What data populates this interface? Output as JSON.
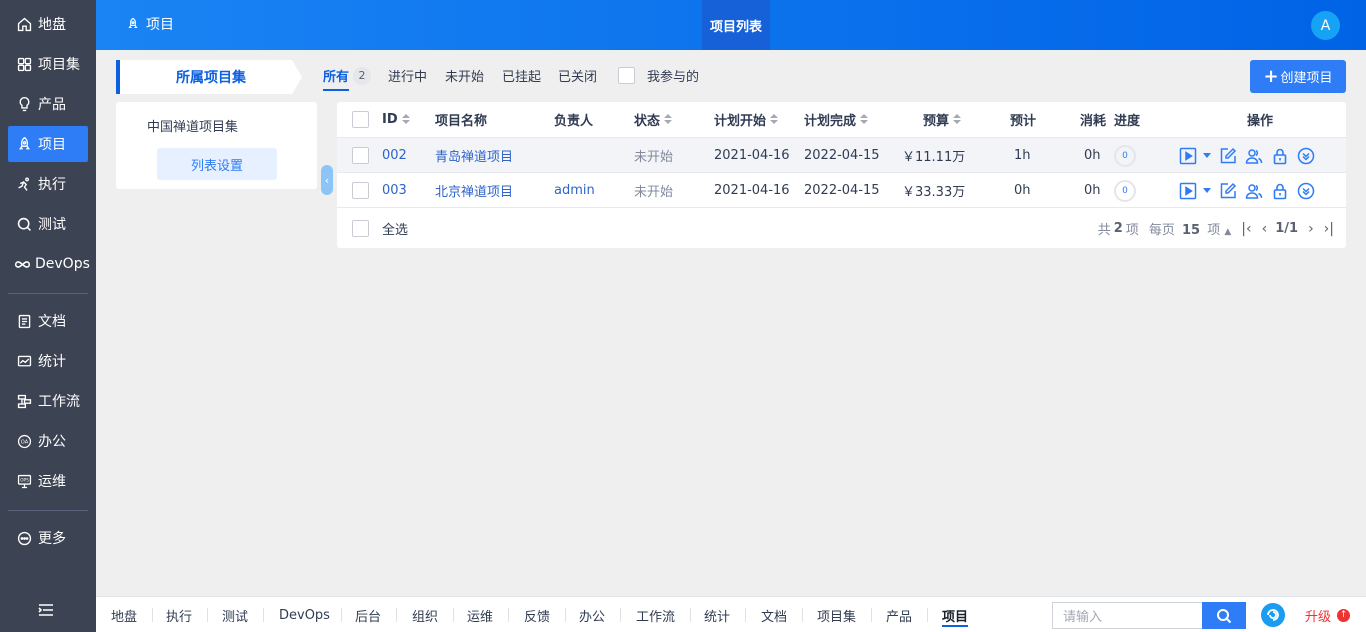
{
  "sidebar": {
    "items": [
      {
        "label": "地盘",
        "icon": "home-icon"
      },
      {
        "label": "项目集",
        "icon": "grid-icon"
      },
      {
        "label": "产品",
        "icon": "bulb-icon"
      },
      {
        "label": "项目",
        "icon": "rocket-icon",
        "active": true
      },
      {
        "label": "执行",
        "icon": "run-icon"
      },
      {
        "label": "测试",
        "icon": "test-icon"
      },
      {
        "label": "DevOps",
        "icon": "infinity-icon"
      },
      {
        "label": "文档",
        "icon": "doc-icon"
      },
      {
        "label": "统计",
        "icon": "chart-icon"
      },
      {
        "label": "工作流",
        "icon": "workflow-icon"
      },
      {
        "label": "办公",
        "icon": "oa-icon"
      },
      {
        "label": "运维",
        "icon": "ops-icon"
      },
      {
        "label": "更多",
        "icon": "more-icon"
      }
    ]
  },
  "header": {
    "module": "项目",
    "active_tab": "项目列表",
    "avatar": "A"
  },
  "left_panel": {
    "title": "所属项目集",
    "group": "中国禅道项目集",
    "button": "列表设置"
  },
  "filters": {
    "all": "所有",
    "all_count": "2",
    "doing": "进行中",
    "wait": "未开始",
    "suspended": "已挂起",
    "closed": "已关闭",
    "mine": "我参与的"
  },
  "create_button": "创建项目",
  "table": {
    "headers": {
      "id": "ID",
      "name": "项目名称",
      "pm": "负责人",
      "status": "状态",
      "begin": "计划开始",
      "end": "计划完成",
      "budget": "预算",
      "estimate": "预计",
      "consumed": "消耗",
      "progress": "进度",
      "actions": "操作"
    },
    "rows": [
      {
        "id": "002",
        "name": "青岛禅道项目",
        "pm": "",
        "status": "未开始",
        "begin": "2021-04-16",
        "end": "2022-04-15",
        "budget": "￥11.11万",
        "estimate": "1h",
        "consumed": "0h",
        "progress": "0"
      },
      {
        "id": "003",
        "name": "北京禅道项目",
        "pm": "admin",
        "status": "未开始",
        "begin": "2021-04-16",
        "end": "2022-04-15",
        "budget": "￥33.33万",
        "estimate": "0h",
        "consumed": "0h",
        "progress": "0"
      }
    ],
    "select_all": "全选",
    "pager": {
      "total_prefix": "共",
      "total": "2",
      "total_suffix": "项",
      "per_page_prefix": "每页",
      "per_page": "15",
      "per_page_suffix": "项",
      "page": "1/1"
    }
  },
  "bottombar": {
    "items": [
      "地盘",
      "执行",
      "测试",
      "DevOps",
      "后台",
      "组织",
      "运维",
      "反馈",
      "办公",
      "工作流",
      "统计",
      "文档",
      "项目集",
      "产品",
      "项目"
    ],
    "search_placeholder": "请输入",
    "upgrade": "升级"
  },
  "colors": {
    "primary": "#2e7cf6",
    "sidebar_bg": "#3c4353",
    "header_gradient_start": "#1a84f4",
    "header_gradient_end": "#0063e6",
    "upgrade_red": "#ee3333"
  }
}
